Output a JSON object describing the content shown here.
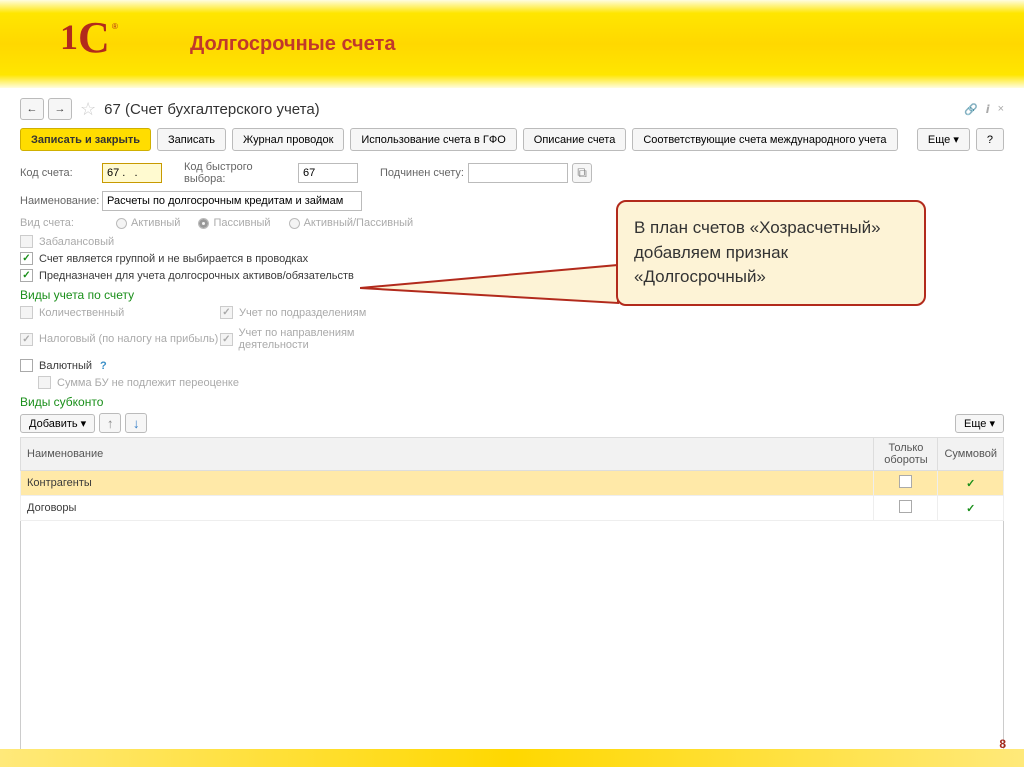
{
  "banner": {
    "title": "Долгосрочные счета",
    "logo": {
      "one": "1",
      "c": "C",
      "tm": "®"
    }
  },
  "page_number": "8",
  "callout": "В план счетов «Хозрасчетный» добавляем признак «Долгосрочный»",
  "header": {
    "title": "67 (Счет бухгалтерского учета)"
  },
  "toolbar": {
    "write_close": "Записать и закрыть",
    "write": "Записать",
    "journal": "Журнал проводок",
    "usage": "Использование счета в ГФО",
    "desc": "Описание счета",
    "intl": "Соответствующие счета международного учета",
    "more": "Еще"
  },
  "fields": {
    "code_label": "Код счета:",
    "code_value": "67 .   .",
    "quick_label": "Код быстрого выбора:",
    "quick_value": "67",
    "parent_label": "Подчинен счету:",
    "parent_value": "",
    "name_label": "Наименование:",
    "name_value": "Расчеты по долгосрочным кредитам и займам"
  },
  "account_type": {
    "label": "Вид счета:",
    "active": "Активный",
    "passive": "Пассивный",
    "both": "Активный/Пассивный",
    "selected": "passive"
  },
  "checks": {
    "offbalance": "Забалансовый",
    "group": "Счет является группой и не выбирается в проводках",
    "longterm": "Предназначен для учета долгосрочных активов/обязательств"
  },
  "accounting_types": {
    "title": "Виды учета по счету",
    "qty": "Количественный",
    "div": "Учет по подразделениям",
    "tax": "Налоговый (по налогу на прибыль)",
    "dir": "Учет по направлениям деятельности",
    "cur": "Валютный",
    "reval": "Сумма БУ не подлежит переоценке"
  },
  "subkonto": {
    "title": "Виды субконто",
    "add": "Добавить",
    "more": "Еще",
    "columns": {
      "name": "Наименование",
      "turnover": "Только обороты",
      "sum": "Суммовой"
    },
    "rows": [
      {
        "name": "Контрагенты",
        "turnover": false,
        "sum": true
      },
      {
        "name": "Договоры",
        "turnover": false,
        "sum": true
      }
    ]
  }
}
